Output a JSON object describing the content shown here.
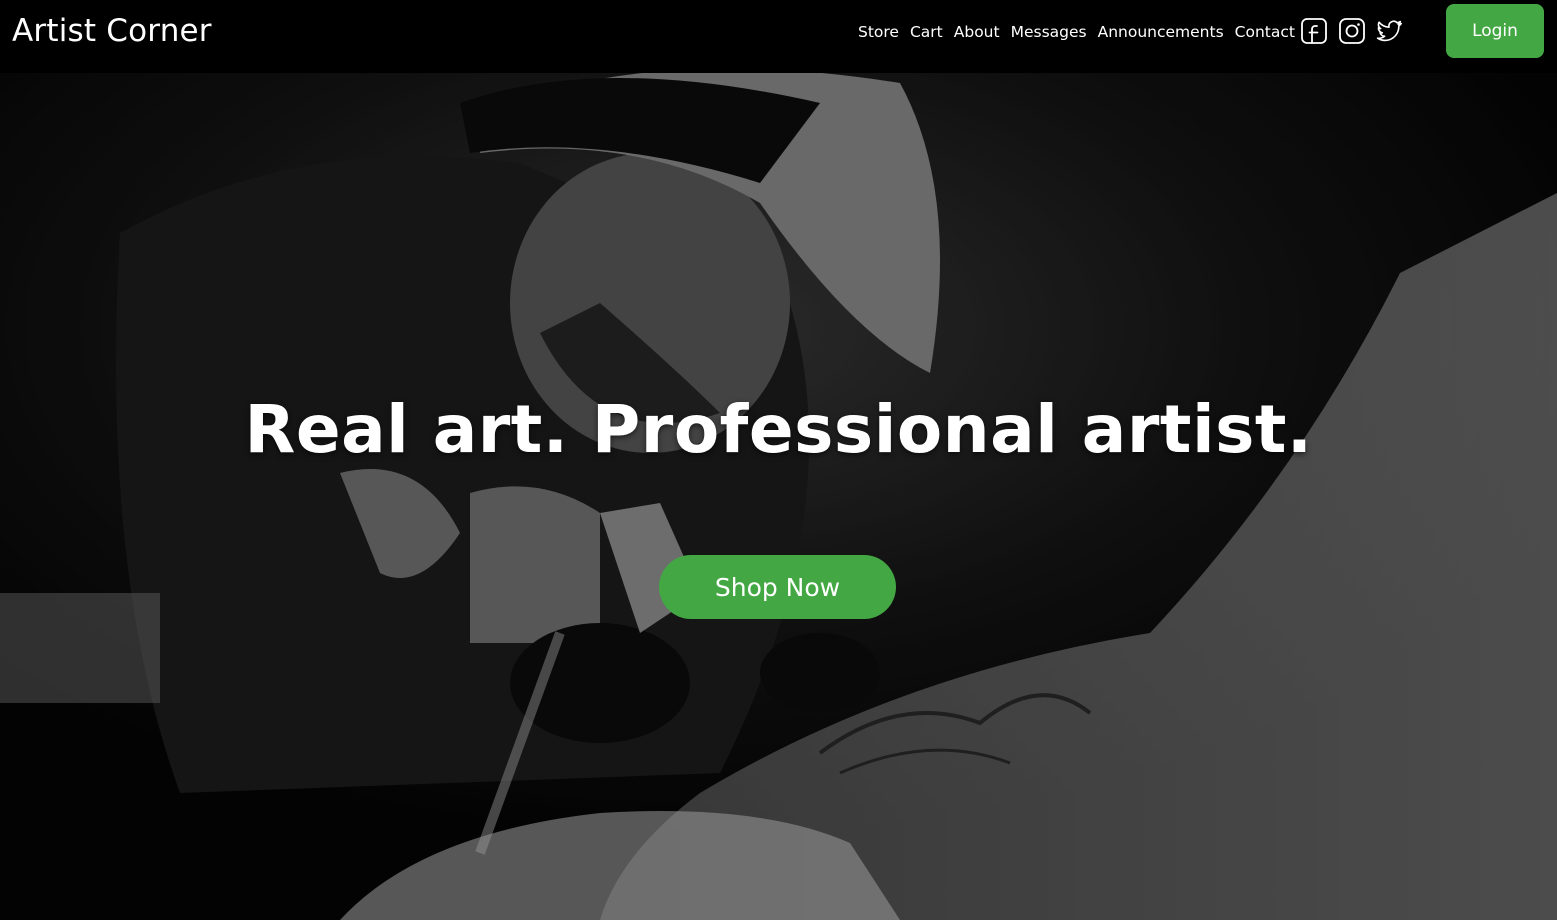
{
  "brand": {
    "name": "Artist Corner"
  },
  "nav": {
    "links": [
      {
        "label": "Store"
      },
      {
        "label": "Cart"
      },
      {
        "label": "About"
      },
      {
        "label": "Messages"
      },
      {
        "label": "Announcements"
      },
      {
        "label": "Contact"
      }
    ],
    "social_icons": [
      "facebook-icon",
      "instagram-icon",
      "twitter-icon"
    ],
    "login_label": "Login"
  },
  "hero": {
    "title": "Real art. Professional artist.",
    "cta_label": "Shop Now",
    "image_description_icon": "tattoo-artist-photo"
  },
  "colors": {
    "accent": "#43a843",
    "nav_bg": "#000000",
    "text": "#ffffff"
  }
}
